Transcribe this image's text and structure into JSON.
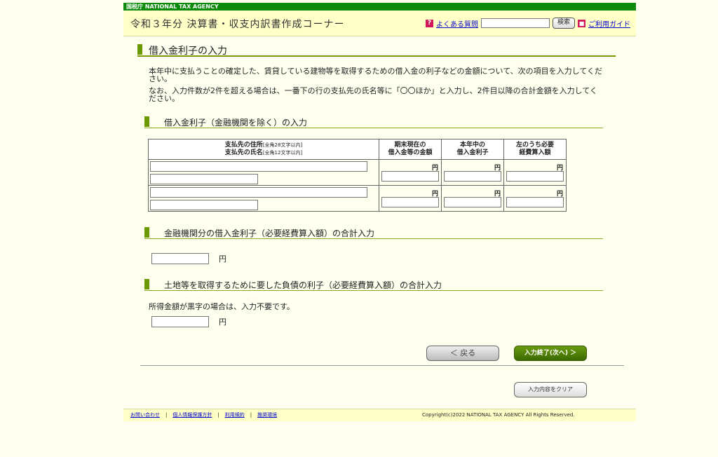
{
  "header": {
    "agency": "国税庁 NATIONAL TAX AGENCY",
    "app_title": "令和３年分 決算書・収支内訳書作成コーナー",
    "faq_link": "よくある質問",
    "search_button": "検索",
    "guide_link": "ご利用ガイド"
  },
  "main": {
    "title": "借入金利子の入力",
    "intro": "本年中に支払うことの確定した、賃貸している建物等を取得するための借入金の利子などの金額について、次の項目を入力してください。",
    "note": "なお、入力件数が2件を超える場合は、一番下の行の支払先の氏名等に「〇〇ほか」と入力し、2件目以降の合計金額を入力してください。",
    "section1": {
      "title": "借入金利子（金融機関を除く）の入力",
      "col_address": "支払先の住所",
      "col_address_hint": "[全角28文字以内]",
      "col_name": "支払先の氏名",
      "col_name_hint": "[全角12文字以内]",
      "col_balance_1": "期末現在の",
      "col_balance_2": "借入金等の金額",
      "col_interest_1": "本年中の",
      "col_interest_2": "借入金利子",
      "col_expense_1": "左のうち必要",
      "col_expense_2": "経費算入額",
      "yen": "円"
    },
    "section2": {
      "title": "金融機関分の借入金利子（必要経費算入額）の合計入力",
      "unit": "円"
    },
    "section3": {
      "title": "土地等を取得するために要した負債の利子（必要経費算入額）の合計入力",
      "note": "所得金額が黒字の場合は、入力不要です。",
      "unit": "円"
    }
  },
  "buttons": {
    "back": "＜ 戻る",
    "next": "入力終了(次へ) ＞",
    "clear": "入力内容をクリア"
  },
  "footer": {
    "links": [
      "お問い合わせ",
      "個人情報保護方針",
      "利用規約",
      "推奨環境"
    ],
    "copyright": "Copyright(c)2022 NATIONAL TAX AGENCY All Rights Reserved."
  }
}
